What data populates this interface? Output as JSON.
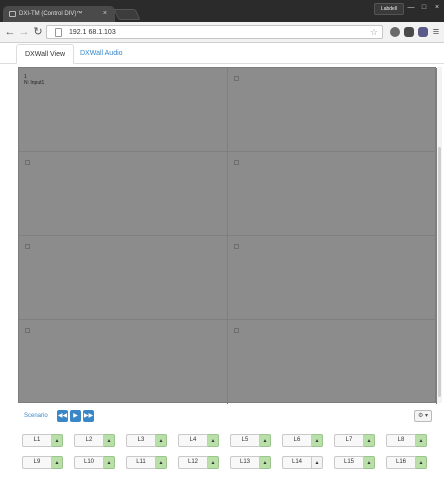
{
  "browser": {
    "tab_title": "DXI-TM (Control DIV)™",
    "tab_close": "×",
    "profile_label": "Labdell",
    "window_controls": [
      "—",
      "□",
      "×"
    ],
    "url": "192.1 68.1.103",
    "back": "←",
    "forward": "→",
    "reload": "↻",
    "star": "☆",
    "menu": "≡"
  },
  "app_tabs": [
    {
      "label": "DXWall View",
      "active": true
    },
    {
      "label": "DXWall Audio",
      "active": false
    }
  ],
  "wall": {
    "cells": [
      {
        "label_line1": "1",
        "label_line2": "N: Input1"
      },
      {
        "label_line1": "",
        "label_line2": ""
      },
      {
        "label_line1": "",
        "label_line2": ""
      },
      {
        "label_line1": "",
        "label_line2": ""
      },
      {
        "label_line1": "",
        "label_line2": ""
      },
      {
        "label_line1": "",
        "label_line2": ""
      },
      {
        "label_line1": "",
        "label_line2": ""
      },
      {
        "label_line1": "",
        "label_line2": ""
      }
    ]
  },
  "scenario": {
    "label": "Scenario",
    "rewind": "◀◀",
    "play": "▶",
    "forward": "▶▶",
    "settings": "⚙ ▾"
  },
  "layout_buttons": [
    {
      "label": "L1",
      "arrow": "▲",
      "active": true
    },
    {
      "label": "L2",
      "arrow": "▲",
      "active": true
    },
    {
      "label": "L3",
      "arrow": "▲",
      "active": true
    },
    {
      "label": "L4",
      "arrow": "▲",
      "active": true
    },
    {
      "label": "L5",
      "arrow": "▲",
      "active": true
    },
    {
      "label": "L6",
      "arrow": "▲",
      "active": true
    },
    {
      "label": "L7",
      "arrow": "▲",
      "active": true
    },
    {
      "label": "L8",
      "arrow": "▲",
      "active": true
    },
    {
      "label": "L9",
      "arrow": "▲",
      "active": true
    },
    {
      "label": "L10",
      "arrow": "▲",
      "active": true
    },
    {
      "label": "L11",
      "arrow": "▲",
      "active": true
    },
    {
      "label": "L12",
      "arrow": "▲",
      "active": true
    },
    {
      "label": "L13",
      "arrow": "▲",
      "active": true
    },
    {
      "label": "L14",
      "arrow": "▲",
      "active": false
    },
    {
      "label": "L15",
      "arrow": "▲",
      "active": true
    },
    {
      "label": "L16",
      "arrow": "▲",
      "active": true
    }
  ]
}
